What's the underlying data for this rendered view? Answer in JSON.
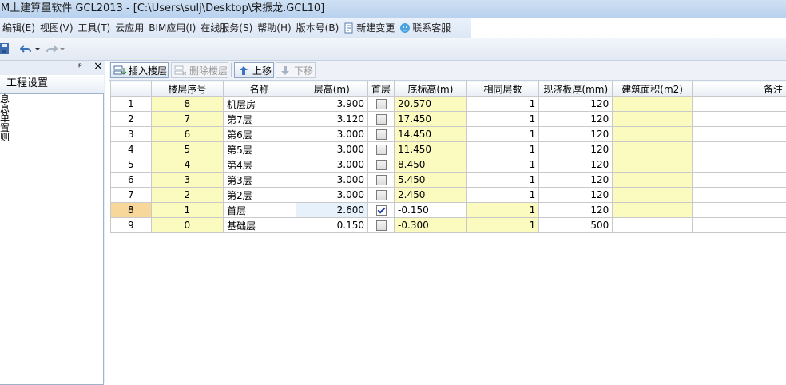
{
  "window": {
    "title": "M土建算量软件 GCL2013 - [C:\\Users\\sulj\\Desktop\\宋振龙.GCL10]"
  },
  "menu": [
    {
      "name": "menu-edit",
      "label": "编辑(E)"
    },
    {
      "name": "menu-view",
      "label": "视图(V)"
    },
    {
      "name": "menu-tools",
      "label": "工具(T)"
    },
    {
      "name": "menu-cloud",
      "label": "云应用"
    },
    {
      "name": "menu-bim",
      "label": "BIM应用(I)"
    },
    {
      "name": "menu-online",
      "label": "在线服务(S)"
    },
    {
      "name": "menu-help",
      "label": "帮助(H)"
    },
    {
      "name": "menu-version",
      "label": "版本号(B)"
    },
    {
      "name": "menu-new-change",
      "label": "新建变更",
      "icon": "document-icon"
    },
    {
      "name": "menu-contact",
      "label": "联系客服",
      "icon": "support-icon"
    }
  ],
  "left_panel": {
    "pin": "ᵖ",
    "close": "×",
    "tab_label": "工程设置",
    "items": [
      "息",
      "息",
      "单",
      "置",
      "则"
    ]
  },
  "grid_toolbar": {
    "insert": "插入楼层",
    "delete": "删除楼层",
    "up": "上移",
    "down": "下移"
  },
  "grid": {
    "columns": [
      "楼层序号",
      "名称",
      "层高(m)",
      "首层",
      "底标高(m)",
      "相同层数",
      "现浇板厚(mm)",
      "建筑面积(m2)",
      "备注"
    ],
    "rows": [
      {
        "n": "1",
        "seq": "8",
        "name": "机层房",
        "height": "3.900",
        "first": false,
        "base": "20.570",
        "same": "1",
        "slab": "120",
        "area": "",
        "note": ""
      },
      {
        "n": "2",
        "seq": "7",
        "name": "第7层",
        "height": "3.120",
        "first": false,
        "base": "17.450",
        "same": "1",
        "slab": "120",
        "area": "",
        "note": ""
      },
      {
        "n": "3",
        "seq": "6",
        "name": "第6层",
        "height": "3.000",
        "first": false,
        "base": "14.450",
        "same": "1",
        "slab": "120",
        "area": "",
        "note": ""
      },
      {
        "n": "4",
        "seq": "5",
        "name": "第5层",
        "height": "3.000",
        "first": false,
        "base": "11.450",
        "same": "1",
        "slab": "120",
        "area": "",
        "note": ""
      },
      {
        "n": "5",
        "seq": "4",
        "name": "第4层",
        "height": "3.000",
        "first": false,
        "base": "8.450",
        "same": "1",
        "slab": "120",
        "area": "",
        "note": ""
      },
      {
        "n": "6",
        "seq": "3",
        "name": "第3层",
        "height": "3.000",
        "first": false,
        "base": "5.450",
        "same": "1",
        "slab": "120",
        "area": "",
        "note": ""
      },
      {
        "n": "7",
        "seq": "2",
        "name": "第2层",
        "height": "3.000",
        "first": false,
        "base": "2.450",
        "same": "1",
        "slab": "120",
        "area": "",
        "note": ""
      },
      {
        "n": "8",
        "seq": "1",
        "name": "首层",
        "height": "2.600",
        "first": true,
        "base": "-0.150",
        "same": "1",
        "slab": "120",
        "area": "",
        "note": ""
      },
      {
        "n": "9",
        "seq": "0",
        "name": "基础层",
        "height": "0.150",
        "first": false,
        "base": "-0.300",
        "same": "1",
        "slab": "500",
        "area": "",
        "note": ""
      }
    ],
    "active_row": 7,
    "colors": {
      "editable": "#fbfbc0",
      "active_row": "#f7d79a",
      "selected_header": "#f7c96a"
    }
  }
}
